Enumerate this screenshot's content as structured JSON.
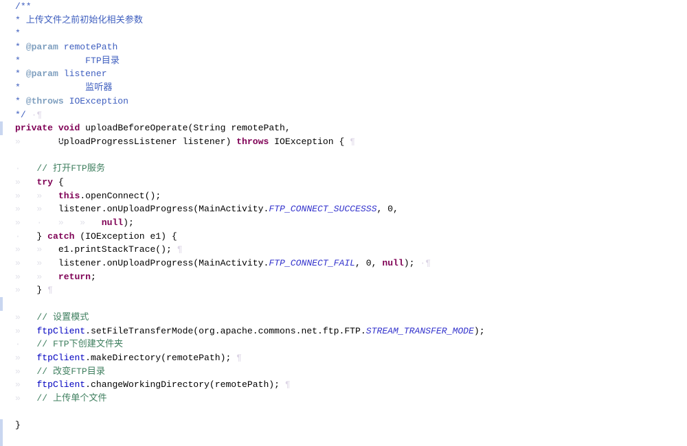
{
  "editor": {
    "kind": "java-source-editor",
    "language": "Java",
    "background": "#ffffff",
    "colors": {
      "keyword": "#7f0055",
      "javadoc": "#3f5fbf",
      "javadoc_tag": "#7f9fbf",
      "line_comment": "#3f7f5f",
      "field": "#0000c0",
      "static_field": "#3333cc",
      "plain_text": "#000000",
      "change_bar": "#c9d6f0",
      "whitespace_marker": "#e2e2ea"
    }
  },
  "code": {
    "lines": [
      {
        "id": "l01",
        "indent": "",
        "marker": "",
        "changebar": false,
        "tokens": [
          {
            "t": "/**",
            "c": "jdoc"
          }
        ]
      },
      {
        "id": "l02",
        "indent": " ",
        "marker": "",
        "changebar": false,
        "tokens": [
          {
            "t": "* 上传文件之前初始化相关参数",
            "c": "jdoc"
          }
        ]
      },
      {
        "id": "l03",
        "indent": " ",
        "marker": "",
        "changebar": false,
        "tokens": [
          {
            "t": "*",
            "c": "jdoc"
          }
        ]
      },
      {
        "id": "l04",
        "indent": " ",
        "marker": "",
        "changebar": false,
        "tokens": [
          {
            "t": "* ",
            "c": "jdoc"
          },
          {
            "t": "@param",
            "c": "jdoctag"
          },
          {
            "t": " remotePath",
            "c": "jdoc"
          }
        ]
      },
      {
        "id": "l05",
        "indent": " ",
        "marker": "",
        "changebar": false,
        "tokens": [
          {
            "t": "*            FTP目录",
            "c": "jdoc"
          }
        ]
      },
      {
        "id": "l06",
        "indent": " ",
        "marker": "",
        "changebar": false,
        "tokens": [
          {
            "t": "* ",
            "c": "jdoc"
          },
          {
            "t": "@param",
            "c": "jdoctag"
          },
          {
            "t": " listener",
            "c": "jdoc"
          }
        ]
      },
      {
        "id": "l07",
        "indent": " ",
        "marker": "",
        "changebar": false,
        "tokens": [
          {
            "t": "*            监听器",
            "c": "jdoc"
          }
        ]
      },
      {
        "id": "l08",
        "indent": " ",
        "marker": "",
        "changebar": false,
        "tokens": [
          {
            "t": "* ",
            "c": "jdoc"
          },
          {
            "t": "@throws",
            "c": "jdoctag"
          },
          {
            "t": " IOException",
            "c": "jdoc"
          }
        ]
      },
      {
        "id": "l09",
        "indent": " ",
        "marker": "",
        "changebar": false,
        "tokens": [
          {
            "t": "*/",
            "c": "jdoc"
          },
          {
            "t": " ·¶",
            "c": "pil"
          }
        ]
      },
      {
        "id": "l10",
        "indent": "",
        "marker": "",
        "changebar": true,
        "tokens": [
          {
            "t": "private",
            "c": "kw"
          },
          {
            "t": " ",
            "c": "plain"
          },
          {
            "t": "void",
            "c": "kw"
          },
          {
            "t": " uploadBeforeOperate(String remotePath,",
            "c": "plain"
          }
        ]
      },
      {
        "id": "l11",
        "indent": "",
        "marker": "»       »   ",
        "changebar": false,
        "tokens": [
          {
            "t": "        UploadProgressListener listener) ",
            "c": "plain"
          },
          {
            "t": "throws",
            "c": "kw"
          },
          {
            "t": " IOException { ",
            "c": "plain"
          },
          {
            "t": "¶",
            "c": "pil"
          }
        ]
      },
      {
        "id": "l12",
        "indent": "",
        "marker": "",
        "changebar": false,
        "tokens": []
      },
      {
        "id": "l13",
        "indent": "",
        "marker": "·",
        "changebar": false,
        "tokens": [
          {
            "t": "    // 打开FTP服务",
            "c": "cmt"
          }
        ]
      },
      {
        "id": "l14",
        "indent": "",
        "marker": "»",
        "changebar": false,
        "tokens": [
          {
            "t": "    ",
            "c": "plain"
          },
          {
            "t": "try",
            "c": "kw"
          },
          {
            "t": " {",
            "c": "plain"
          }
        ]
      },
      {
        "id": "l15",
        "indent": "",
        "marker": "»   »",
        "changebar": false,
        "tokens": [
          {
            "t": "        ",
            "c": "plain"
          },
          {
            "t": "this",
            "c": "kw"
          },
          {
            "t": ".openConnect();",
            "c": "plain"
          }
        ]
      },
      {
        "id": "l16",
        "indent": "",
        "marker": "»   »",
        "changebar": false,
        "tokens": [
          {
            "t": "        listener.onUploadProgress(MainActivity.",
            "c": "plain"
          },
          {
            "t": "FTP_CONNECT_SUCCESSS",
            "c": "static"
          },
          {
            "t": ", 0,",
            "c": "plain"
          }
        ]
      },
      {
        "id": "l17",
        "indent": "",
        "marker": "»   ·   »   »",
        "changebar": false,
        "tokens": [
          {
            "t": "                ",
            "c": "plain"
          },
          {
            "t": "null",
            "c": "kw"
          },
          {
            "t": ");",
            "c": "plain"
          }
        ]
      },
      {
        "id": "l18",
        "indent": "",
        "marker": "·",
        "changebar": false,
        "tokens": [
          {
            "t": "    } ",
            "c": "plain"
          },
          {
            "t": "catch",
            "c": "kw"
          },
          {
            "t": " (IOException e1) {",
            "c": "plain"
          }
        ]
      },
      {
        "id": "l19",
        "indent": "",
        "marker": "»   »",
        "changebar": false,
        "tokens": [
          {
            "t": "        e1.printStackTrace(); ",
            "c": "plain"
          },
          {
            "t": "¶",
            "c": "pil"
          }
        ]
      },
      {
        "id": "l20",
        "indent": "",
        "marker": "»   »",
        "changebar": false,
        "tokens": [
          {
            "t": "        listener.onUploadProgress(MainActivity.",
            "c": "plain"
          },
          {
            "t": "FTP_CONNECT_FAIL",
            "c": "static"
          },
          {
            "t": ", 0, ",
            "c": "plain"
          },
          {
            "t": "null",
            "c": "kw"
          },
          {
            "t": ");",
            "c": "plain"
          },
          {
            "t": " ·¶",
            "c": "pil"
          }
        ]
      },
      {
        "id": "l21",
        "indent": "",
        "marker": "»   »",
        "changebar": false,
        "tokens": [
          {
            "t": "        ",
            "c": "plain"
          },
          {
            "t": "return",
            "c": "kw"
          },
          {
            "t": ";",
            "c": "plain"
          }
        ]
      },
      {
        "id": "l22",
        "indent": "",
        "marker": "»",
        "changebar": false,
        "tokens": [
          {
            "t": "    } ",
            "c": "plain"
          },
          {
            "t": "¶",
            "c": "pil"
          }
        ]
      },
      {
        "id": "l23",
        "indent": "",
        "marker": "",
        "changebar": true,
        "tokens": []
      },
      {
        "id": "l24",
        "indent": "",
        "marker": "»",
        "changebar": false,
        "tokens": [
          {
            "t": "    // 设置模式",
            "c": "cmt"
          }
        ]
      },
      {
        "id": "l25",
        "indent": "",
        "marker": "»",
        "changebar": false,
        "tokens": [
          {
            "t": "    ",
            "c": "plain"
          },
          {
            "t": "ftpClient",
            "c": "field"
          },
          {
            "t": ".setFileTransferMode(org.apache.commons.net.ftp.FTP.",
            "c": "plain"
          },
          {
            "t": "STREAM_TRANSFER_MODE",
            "c": "static"
          },
          {
            "t": ");",
            "c": "plain"
          }
        ]
      },
      {
        "id": "l26",
        "indent": "",
        "marker": "·",
        "changebar": false,
        "tokens": [
          {
            "t": "    // FTP下创建文件夹",
            "c": "cmt"
          }
        ]
      },
      {
        "id": "l27",
        "indent": "",
        "marker": "»",
        "changebar": false,
        "tokens": [
          {
            "t": "    ",
            "c": "plain"
          },
          {
            "t": "ftpClient",
            "c": "field"
          },
          {
            "t": ".makeDirectory(remotePath); ",
            "c": "plain"
          },
          {
            "t": "¶",
            "c": "pil"
          }
        ]
      },
      {
        "id": "l28",
        "indent": "",
        "marker": "»",
        "changebar": false,
        "tokens": [
          {
            "t": "    // 改变FTP目录",
            "c": "cmt"
          }
        ]
      },
      {
        "id": "l29",
        "indent": "",
        "marker": "»",
        "changebar": false,
        "tokens": [
          {
            "t": "    ",
            "c": "plain"
          },
          {
            "t": "ftpClient",
            "c": "field"
          },
          {
            "t": ".changeWorkingDirectory(remotePath); ",
            "c": "plain"
          },
          {
            "t": "¶",
            "c": "pil"
          }
        ]
      },
      {
        "id": "l30",
        "indent": "",
        "marker": "»",
        "changebar": false,
        "tokens": [
          {
            "t": "    // 上传单个文件",
            "c": "cmt"
          }
        ]
      },
      {
        "id": "l31",
        "indent": "",
        "marker": "",
        "changebar": false,
        "tokens": []
      },
      {
        "id": "l32",
        "indent": "",
        "marker": "",
        "changebar": true,
        "tokens": [
          {
            "t": "}",
            "c": "plain"
          }
        ]
      },
      {
        "id": "l33",
        "indent": "",
        "marker": "",
        "changebar": true,
        "tokens": []
      }
    ]
  }
}
